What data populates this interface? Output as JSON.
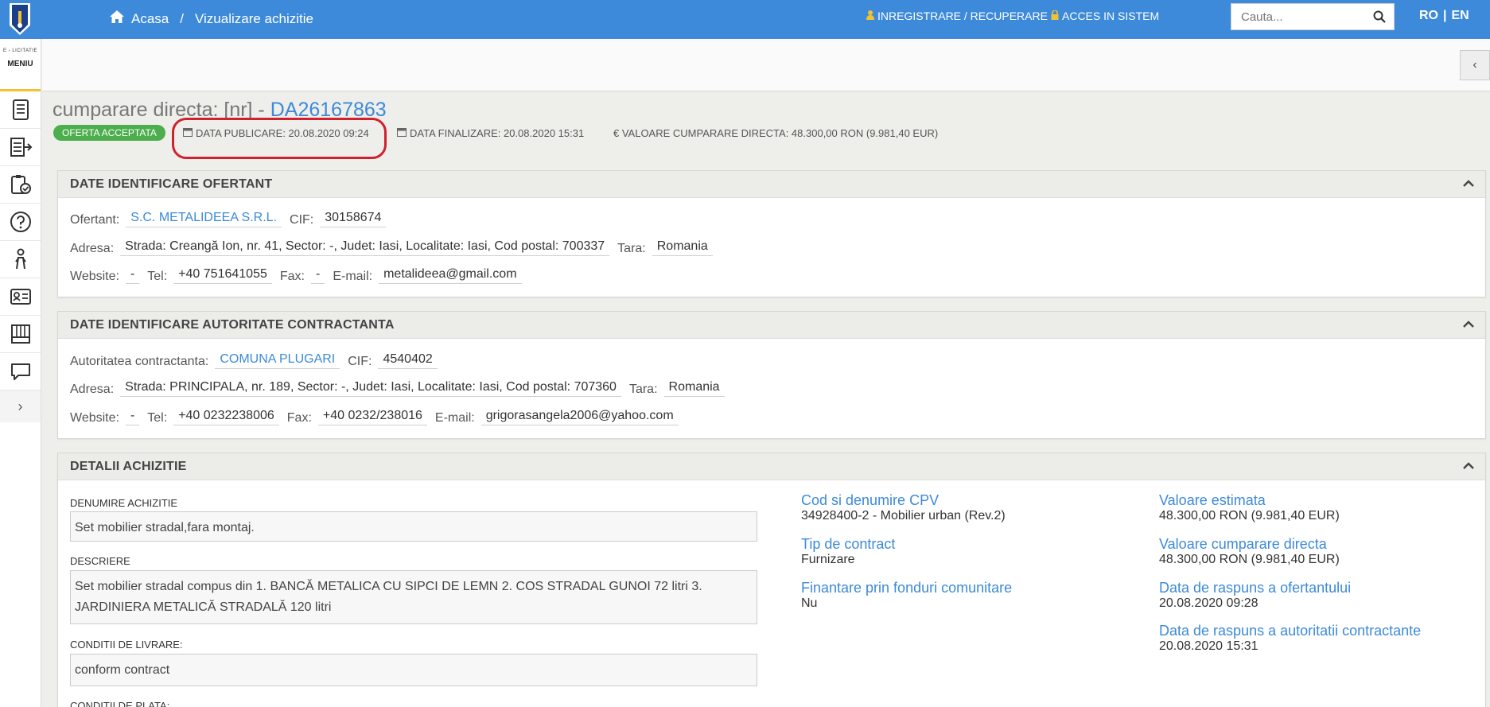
{
  "topbar": {
    "home_label": "Acasa",
    "breadcrumb_sep": "/",
    "page_label": "Vizualizare achizitie",
    "register_label": "INREGISTRARE / RECUPERARE",
    "login_label": "ACCES IN SISTEM",
    "search_placeholder": "Cauta...",
    "lang_ro": "RO",
    "lang_sep": "|",
    "lang_en": "EN"
  },
  "sidebar": {
    "brand_small": "E - LICITATIE",
    "menu_label": "MENIU",
    "icons": [
      "document-icon",
      "list-arrow-icon",
      "clipboard-check-icon",
      "help-icon",
      "person-icon",
      "id-card-icon",
      "catalog-icon",
      "chat-icon"
    ],
    "expand_label": "›"
  },
  "header": {
    "title_prefix": "cumparare directa: [nr] - ",
    "title_code": "DA26167863",
    "status_badge": "OFERTA ACCEPTATA",
    "publish_date": "DATA PUBLICARE: 20.08.2020 09:24",
    "final_date": "DATA FINALIZARE: 20.08.2020 15:31",
    "value": "€ VALOARE CUMPARARE DIRECTA: 48.300,00  RON (9.981,40  EUR)"
  },
  "bidder_panel": {
    "title": "DATE IDENTIFICARE OFERTANT",
    "ofertant_label": "Ofertant:",
    "ofertant": "S.C. METALIDEEA S.R.L.",
    "cif_label": "CIF:",
    "cif": "30158674",
    "address_label": "Adresa:",
    "address": "Strada: Creangă Ion, nr. 41, Sector: -, Judet: Iasi, Localitate: Iasi, Cod postal: 700337",
    "country_label": "Tara:",
    "country": "Romania",
    "website_label": "Website:",
    "website": "-",
    "tel_label": "Tel:",
    "tel": "+40 751641055",
    "fax_label": "Fax:",
    "fax": "-",
    "email_label": "E-mail:",
    "email": "metalideea@gmail.com"
  },
  "authority_panel": {
    "title": "DATE IDENTIFICARE AUTORITATE CONTRACTANTA",
    "authority_label": "Autoritatea contractanta:",
    "authority": "COMUNA PLUGARI",
    "cif_label": "CIF:",
    "cif": "4540402",
    "address_label": "Adresa:",
    "address": "Strada: PRINCIPALA, nr. 189, Sector: -, Judet: Iasi, Localitate: Iasi, Cod postal: 707360",
    "country_label": "Tara:",
    "country": "Romania",
    "website_label": "Website:",
    "website": "-",
    "tel_label": "Tel:",
    "tel": "+40 0232238006",
    "fax_label": "Fax:",
    "fax": "+40 0232/238016",
    "email_label": "E-mail:",
    "email": "grigorasangela2006@yahoo.com"
  },
  "details_panel": {
    "title": "DETALII ACHIZITIE",
    "name_label": "DENUMIRE ACHIZITIE",
    "name": "Set mobilier stradal,fara montaj.",
    "desc_label": "DESCRIERE",
    "desc": "Set mobilier stradal compus din 1. BANCĂ METALICA CU SIPCI DE LEMN 2. COS STRADAL GUNOI 72 litri 3. JARDINIERA METALICĂ STRADALĂ 120 litri",
    "delivery_label": "CONDITII DE LIVRARE:",
    "delivery": "conform contract",
    "payment_label": "CONDITII DE PLATA:",
    "cpv_label": "Cod si denumire CPV",
    "cpv": "34928400-2 - Mobilier urban (Rev.2)",
    "contract_type_label": "Tip de contract",
    "contract_type": "Furnizare",
    "eu_funds_label": "Finantare prin fonduri comunitare",
    "eu_funds": "Nu",
    "estimated_label": "Valoare estimata",
    "estimated": "48.300,00  RON (9.981,40  EUR)",
    "direct_value_label": "Valoare cumparare directa",
    "direct_value": "48.300,00  RON (9.981,40  EUR)",
    "bidder_response_label": "Data de raspuns a ofertantului",
    "bidder_response": "20.08.2020 09:28",
    "authority_response_label": "Data de raspuns a autoritatii contractante",
    "authority_response": "20.08.2020 15:31"
  }
}
